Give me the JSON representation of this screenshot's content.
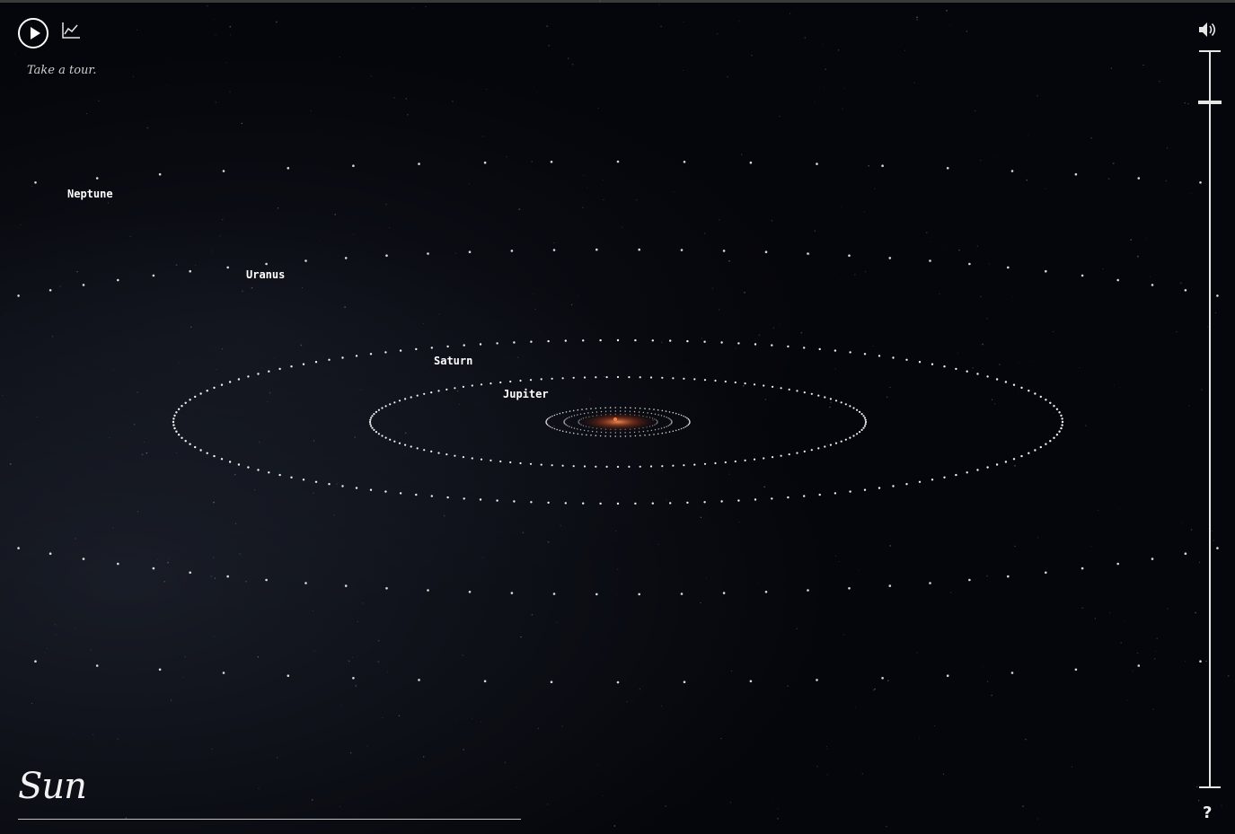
{
  "controls": {
    "play_icon": "play-circle-icon",
    "chart_icon": "line-chart-icon",
    "tour_text": "Take a tour.",
    "volume_icon": "speaker-volume-icon",
    "help_label": "?"
  },
  "zoom": {
    "level": 0.07
  },
  "planets": [
    {
      "name": "Neptune"
    },
    {
      "name": "Uranus"
    },
    {
      "name": "Saturn"
    },
    {
      "name": "Jupiter"
    }
  ],
  "selected_body": "Sun",
  "colors": {
    "background": "#05060b",
    "orbit_dots": "#ffffff",
    "sun": "#d2542a",
    "ui": "#e6e6e6"
  }
}
